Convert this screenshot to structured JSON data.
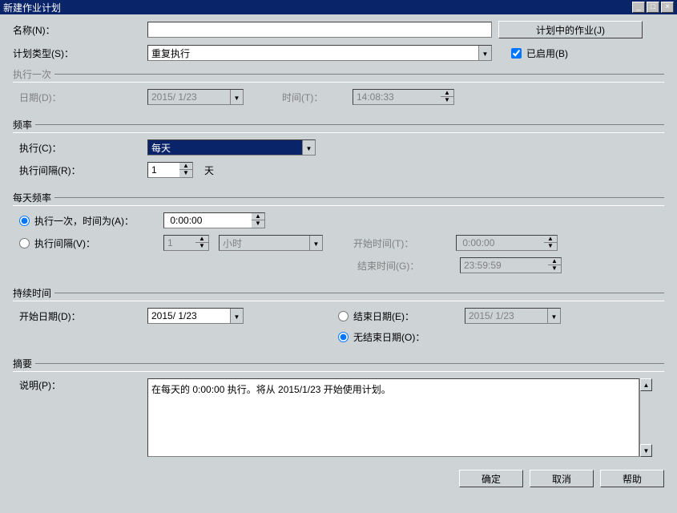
{
  "window": {
    "title": "新建作业计划"
  },
  "labels": {
    "name": "名称(N)：",
    "scheduleType": "计划类型(S)：",
    "jobsInSchedule": "计划中的作业(J)",
    "enabled": "已启用(B)",
    "onceGroup": "执行一次",
    "onceDate": "日期(D)：",
    "onceTime": "时间(T)：",
    "freqGroup": "频率",
    "execute": "执行(C)：",
    "execInterval": "执行间隔(R)：",
    "intervalUnit": "天",
    "dailyGroup": "每天频率",
    "dailyOnce": "执行一次，时间为(A)：",
    "dailyEvery": "执行间隔(V)：",
    "startTime": "开始时间(T)：",
    "endTime": "结束时间(G)：",
    "durationGroup": "持续时间",
    "startDate": "开始日期(D)：",
    "endDate": "结束日期(E)：",
    "noEndDate": "无结束日期(O)：",
    "summaryGroup": "摘要",
    "description": "说明(P)：",
    "ok": "确定",
    "cancel": "取消",
    "help": "帮助"
  },
  "values": {
    "name": "",
    "scheduleType": "重复执行",
    "enabled": true,
    "onceDate": "2015/ 1/23",
    "onceTime": "14:08:33",
    "freqExecute": "每天",
    "freqInterval": "1",
    "dailyMode": "once",
    "dailyOnceTime": " 0:00:00",
    "dailyEveryN": "1",
    "dailyEveryUnit": "小时",
    "dailyStart": " 0:00:00",
    "dailyEnd": "23:59:59",
    "durStart": "2015/ 1/23",
    "durEnd": "2015/ 1/23",
    "durMode": "noend",
    "summary": "在每天的 0:00:00 执行。将从 2015/1/23 开始使用计划。"
  }
}
